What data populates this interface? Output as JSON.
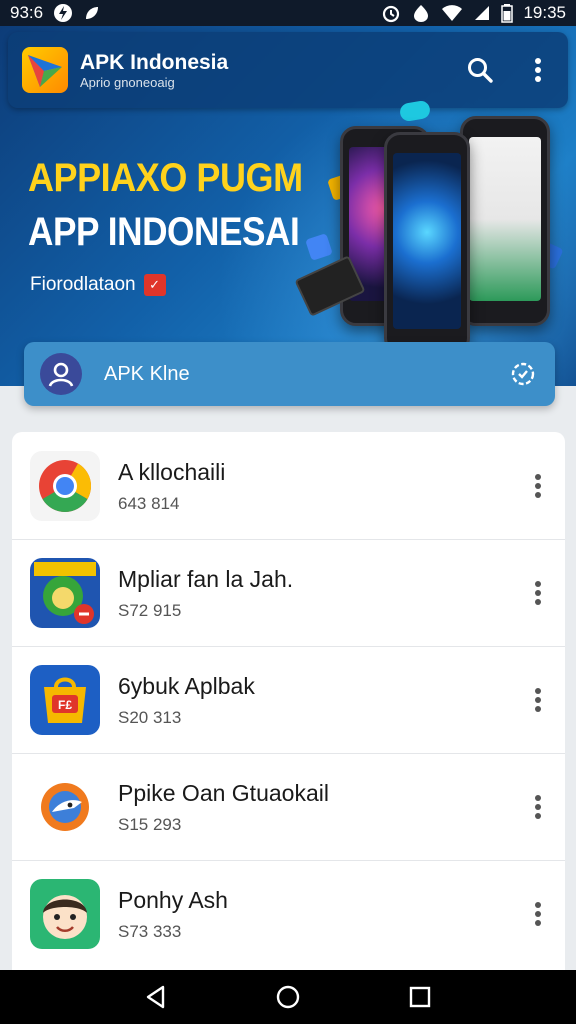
{
  "status_bar": {
    "time_left": "93:6",
    "time_right": "19:35",
    "icons": [
      "flash-icon",
      "leaf-icon",
      "alarm-icon",
      "data-icon",
      "wifi-icon",
      "signal-icon",
      "battery-icon"
    ]
  },
  "app_bar": {
    "title": "APK Indonesia",
    "subtitle": "Aprio gnoneoaig",
    "search_icon": "search-icon",
    "menu_icon": "more-vert-icon"
  },
  "hero": {
    "headline": "APPIAXO PUGM",
    "headline2": "APP INDONESAI",
    "sub_label": "Fiorodlataon"
  },
  "search": {
    "text": "APK Klne",
    "avatar_icon": "user-icon",
    "action_icon": "settings-icon"
  },
  "apps": [
    {
      "name": "A kllochaili",
      "meta": "643 814",
      "icon": "chrome-icon"
    },
    {
      "name": "Mpliar fan la Jah.",
      "meta": "S72 915",
      "icon": "game-icon"
    },
    {
      "name": "6ybuk Aplbak",
      "meta": "S20 313",
      "icon": "store-icon"
    },
    {
      "name": "Ppike Oan Gtuaokail",
      "meta": "S15 293",
      "icon": "bird-icon"
    },
    {
      "name": "Ponhy Ash",
      "meta": "S73 333",
      "icon": "face-icon"
    }
  ],
  "colors": {
    "accent": "#3d8fc9",
    "hero_headline": "#ffd21c",
    "hero_bg": "#1260a8"
  }
}
